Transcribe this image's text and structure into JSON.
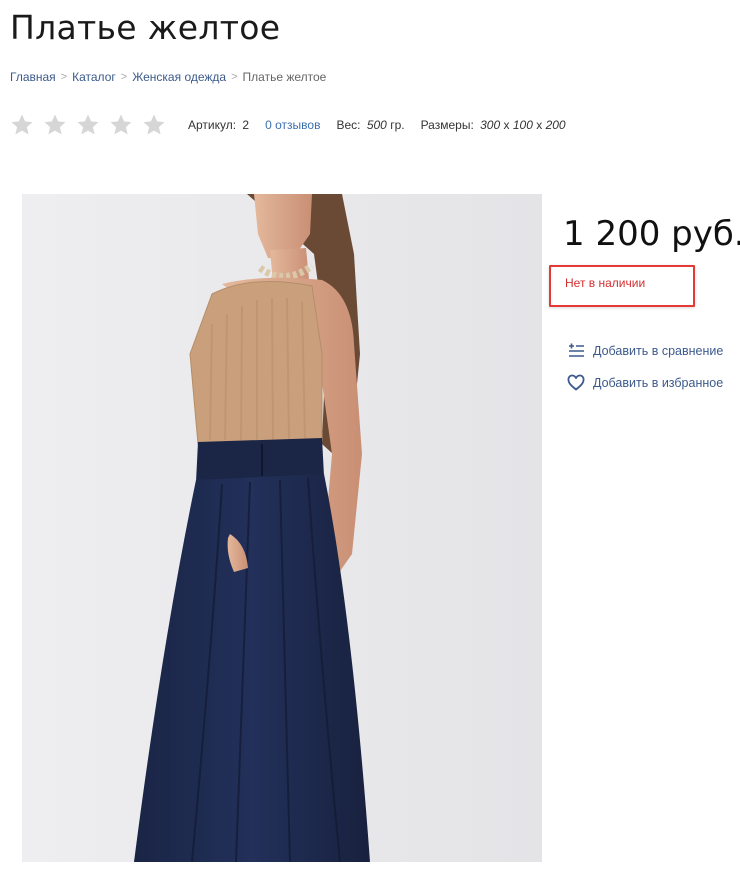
{
  "product": {
    "title": "Платье желтое",
    "price": "1 200 руб.",
    "stock_status": "Нет в наличии",
    "rating": 0,
    "rating_max": 5,
    "photo_alt": "Платье желтое"
  },
  "breadcrumb": {
    "items": [
      "Главная",
      "Каталог",
      "Женская одежда"
    ],
    "current": "Платье желтое",
    "separator": ">"
  },
  "meta": {
    "article_label": "Артикул:",
    "article_value": "2",
    "reviews_label": "0 отзывов",
    "weight_label": "Вес:",
    "weight_value": "500",
    "weight_unit": "гр.",
    "sizes_label": "Размеры:",
    "size_w": "300",
    "size_h": "100",
    "size_d": "200",
    "size_sep": "x"
  },
  "actions": {
    "compare_label": "Добавить в сравнение",
    "favorite_label": "Добавить в избранное"
  },
  "colors": {
    "link": "#3c5a8c",
    "stock_red": "#d32f2f",
    "star_empty": "#d6d6d6",
    "skirt_navy": "#1e2a4a",
    "top_beige": "#c8a27c"
  },
  "icons": {
    "star": "star-icon",
    "compare": "compare-icon",
    "favorite": "heart-icon"
  }
}
